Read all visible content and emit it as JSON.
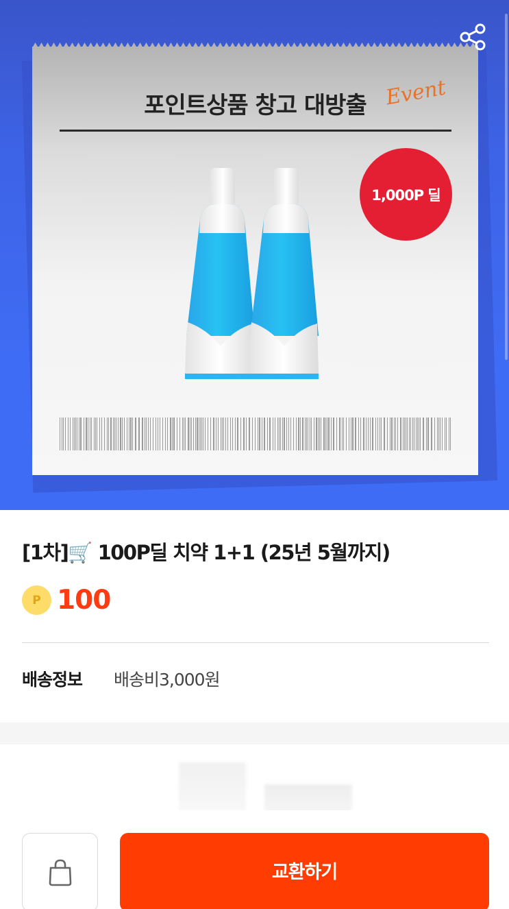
{
  "hero": {
    "card_title": "포인트상품 창고 대방출",
    "card_event": "Event",
    "badge": "1,000P 딜"
  },
  "product": {
    "title": "[1차]🛒 100P딜 치약 1+1 (25년 5월까지)",
    "coin_letter": "P",
    "price": "100"
  },
  "shipping": {
    "label": "배송정보",
    "value": "배송비3,000원"
  },
  "actions": {
    "exchange_label": "교환하기"
  },
  "icons": {
    "share": "share-icon",
    "bag": "shopping-bag-icon"
  },
  "colors": {
    "hero_blue": "#3f6cf4",
    "badge_red": "#e41f33",
    "price_orange": "#ff3b12",
    "cta_orange": "#ff3d03",
    "coin_yellow": "#fddc6a"
  }
}
